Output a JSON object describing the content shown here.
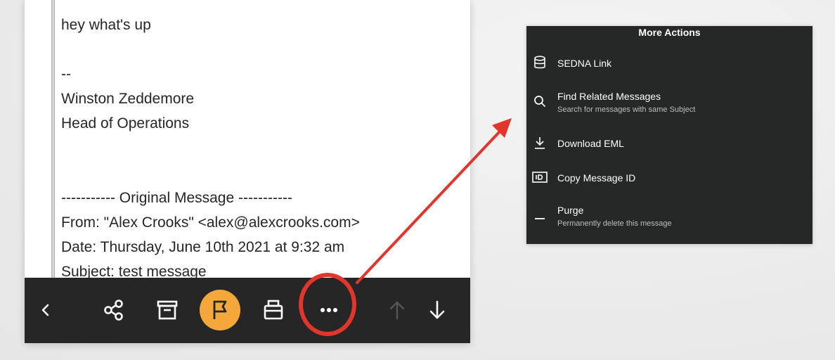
{
  "message": {
    "lines": [
      "hey what's up",
      "",
      "--",
      "Winston Zeddemore",
      "Head of Operations",
      "",
      "",
      "----------- Original Message -----------",
      "From: \"Alex Crooks\" <alex@alexcrooks.com>",
      "Date: Thursday, June 10th 2021 at 9:32 am",
      "Subject: test message"
    ]
  },
  "toolbar": {
    "buttons": [
      {
        "name": "back-button",
        "icon": "chevron-left-icon"
      },
      {
        "name": "share-button",
        "icon": "share-icon"
      },
      {
        "name": "archive-button",
        "icon": "archive-box-icon"
      },
      {
        "name": "flag-button",
        "icon": "flag-icon",
        "active": true
      },
      {
        "name": "print-button",
        "icon": "printer-icon"
      },
      {
        "name": "more-actions-button",
        "icon": "ellipsis-icon",
        "highlighted": true
      },
      {
        "name": "previous-message-button",
        "icon": "arrow-up-icon",
        "disabled": true
      },
      {
        "name": "next-message-button",
        "icon": "arrow-down-icon"
      }
    ]
  },
  "actions_menu": {
    "title": "More Actions",
    "items": [
      {
        "icon": "database-icon",
        "label": "SEDNA Link",
        "sub": ""
      },
      {
        "icon": "search-icon",
        "label": "Find Related Messages",
        "sub": "Search for messages with same Subject"
      },
      {
        "icon": "download-icon",
        "label": "Download EML",
        "sub": ""
      },
      {
        "icon": "id-card-icon",
        "label": "Copy Message ID",
        "sub": ""
      },
      {
        "icon": "dash-icon",
        "label": "Purge",
        "sub": "Permanently delete this message"
      }
    ]
  },
  "colors": {
    "toolbar_bg": "#262626",
    "flag_accent": "#f4a83a",
    "highlight_red": "#e2352b",
    "menu_bg": "#262727"
  }
}
